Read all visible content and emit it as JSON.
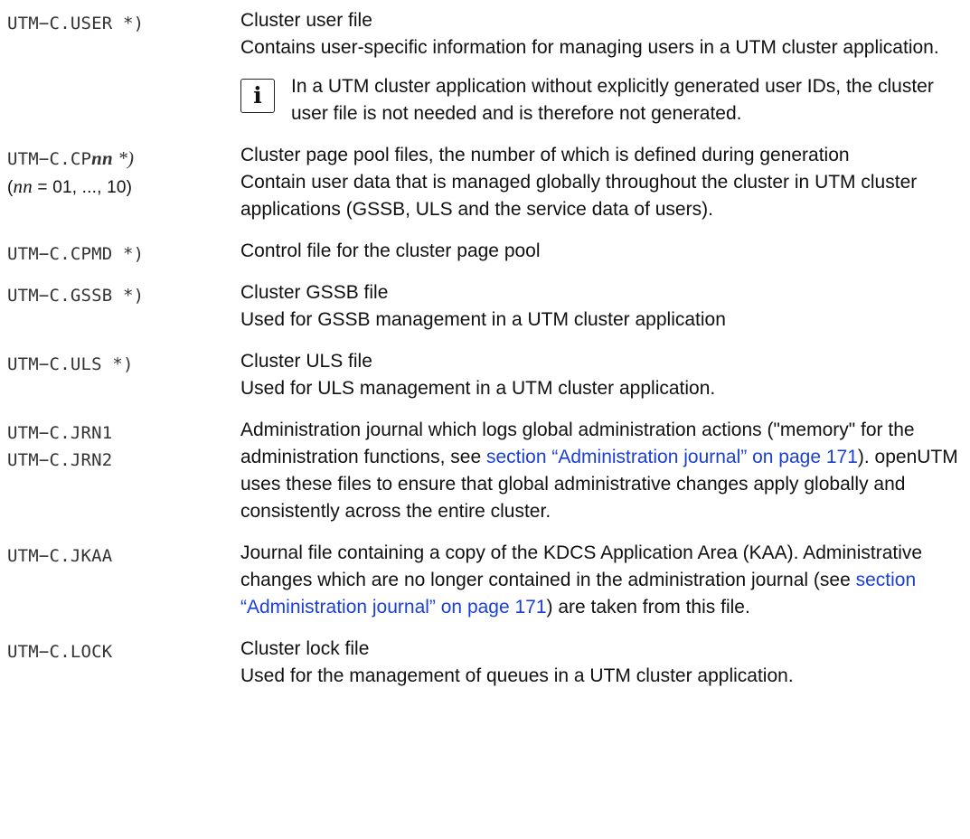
{
  "entries": [
    {
      "term": "UTM−C.USER *)",
      "title": "Cluster user file",
      "text": "Contains user-specific information for managing users in a UTM cluster application.",
      "note": "In a UTM cluster application without explicitly generated user IDs, the cluster user file is not needed and is therefore not generated.",
      "note_icon": "i"
    },
    {
      "term_prefix": "UTM−C.CP",
      "term_var": "nn",
      "term_suffix": " *)",
      "range_var": "nn",
      "range_rest": " = 01, ..., 10)",
      "range_open": "(",
      "title": "Cluster page pool files, the number of which is defined during generation",
      "text": "Contain user data that is managed globally throughout the cluster in UTM cluster applications (GSSB, ULS and the service data of users)."
    },
    {
      "term": "UTM−C.CPMD *)",
      "title": "Control file for the cluster page pool"
    },
    {
      "term": "UTM−C.GSSB *)",
      "title": "Cluster GSSB file",
      "text": "Used for GSSB management in a UTM cluster application"
    },
    {
      "term": "UTM−C.ULS *)",
      "title": "Cluster ULS file",
      "text": "Used for ULS management in a UTM cluster application."
    },
    {
      "term": "UTM−C.JRN1",
      "term2": "UTM−C.JRN2",
      "text_a": "Administration journal which logs global administration actions (\"memory\" for the administration functions, see ",
      "link": "section “Administration journal” on page 171",
      "text_b": "). openUTM uses these files to ensure that global administrative changes apply globally and consistently across the entire cluster."
    },
    {
      "term": "UTM−C.JKAA",
      "text_a": "Journal file containing a copy of the KDCS Application Area (KAA). Administrative changes which are no longer contained in the administration journal (see ",
      "link": "section “Administration journal” on page 171",
      "text_b": ") are taken from this file."
    },
    {
      "term": "UTM−C.LOCK",
      "title": "Cluster lock file",
      "text": "Used for the management of queues in a UTM cluster application."
    }
  ]
}
